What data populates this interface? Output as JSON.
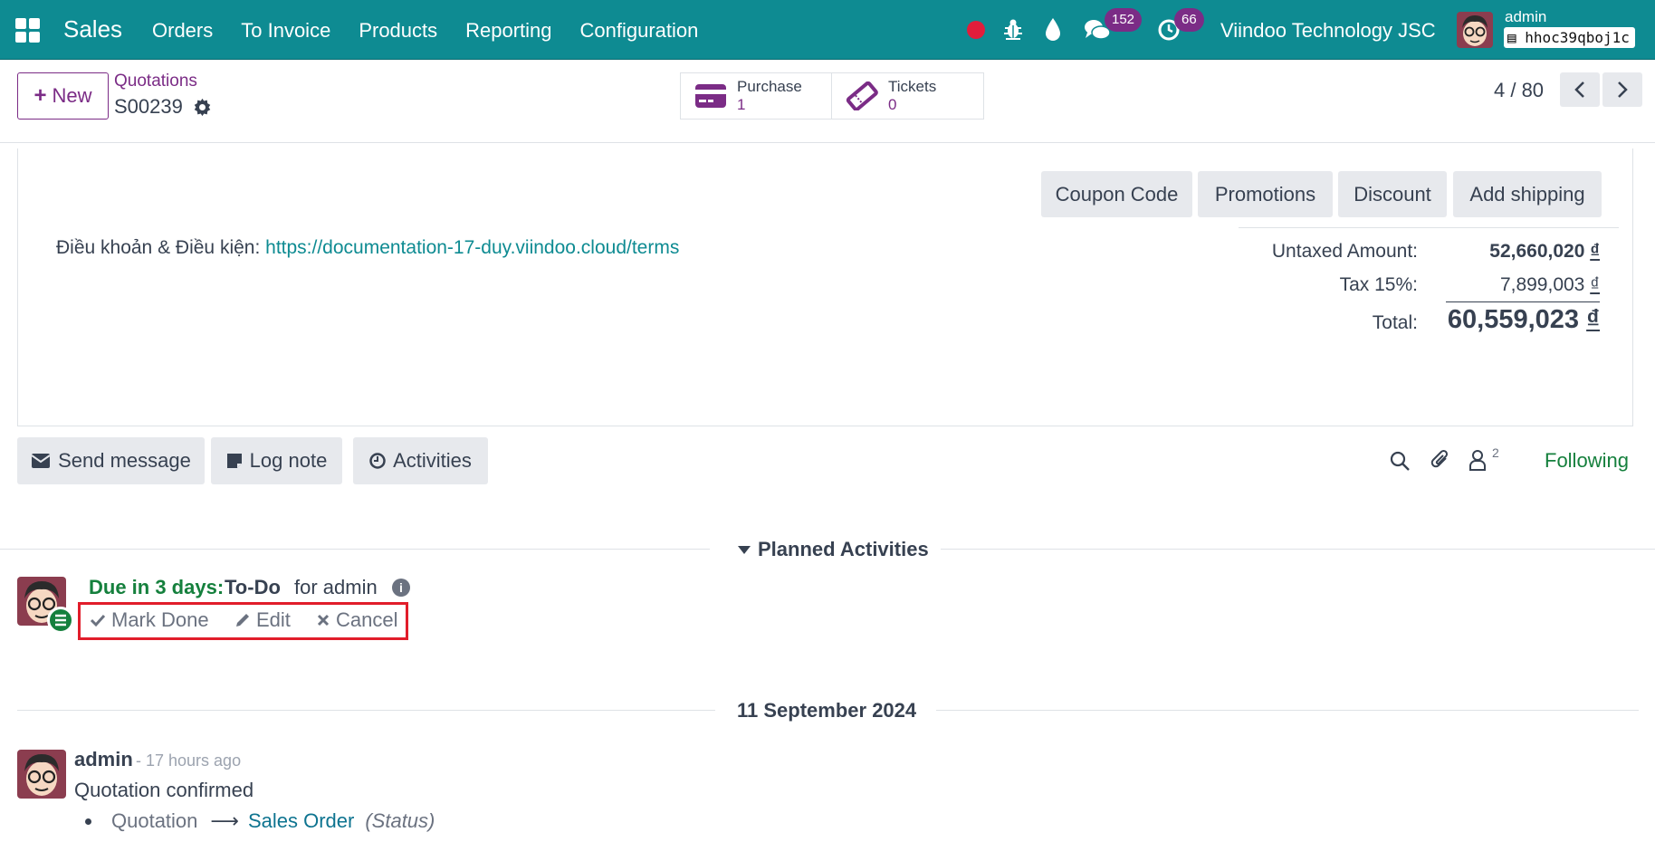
{
  "navbar": {
    "app_name": "Sales",
    "menu": [
      "Orders",
      "To Invoice",
      "Products",
      "Reporting",
      "Configuration"
    ],
    "messages_count": "152",
    "activities_count": "66",
    "company": "Viindoo Technology JSC",
    "user": "admin",
    "database": "hhoc39qboj1c",
    "colors": {
      "navbar": "#0e8b92",
      "badge": "#7b2c86",
      "recording": "#e11d3b"
    }
  },
  "control_panel": {
    "new_label": "New",
    "breadcrumb": "Quotations",
    "record_name": "S00239",
    "smart_buttons": [
      {
        "label": "Purchase",
        "value": "1",
        "icon": "credit-card-icon"
      },
      {
        "label": "Tickets",
        "value": "0",
        "icon": "ticket-icon"
      }
    ],
    "pager": "4 / 80"
  },
  "sheet": {
    "buttons": [
      "Coupon Code",
      "Promotions",
      "Discount",
      "Add shipping"
    ],
    "terms_label": "Điều khoản & Điều kiện: ",
    "terms_link": "https://documentation-17-duy.viindoo.cloud/terms",
    "totals": {
      "untaxed_label": "Untaxed Amount:",
      "untaxed_value": "52,660,020",
      "tax_label": "Tax 15%:",
      "tax_value": "7,899,003",
      "total_label": "Total:",
      "total_value": "60,559,023",
      "currency": "₫"
    }
  },
  "chatter": {
    "send_message": "Send message",
    "log_note": "Log note",
    "activities": "Activities",
    "followers_count": "2",
    "following": "Following",
    "planned_title": "Planned Activities",
    "activity": {
      "due": "Due in 3 days:",
      "type": "To-Do",
      "assignee": "for admin",
      "mark_done": "Mark Done",
      "edit": "Edit",
      "cancel": "Cancel"
    },
    "date_separator": "11 September 2024",
    "message": {
      "author": "admin",
      "time": "- 17 hours ago",
      "body": "Quotation confirmed",
      "old_value": "Quotation",
      "arrow": "⟶",
      "new_value": "Sales Order",
      "field": "(Status)"
    }
  }
}
